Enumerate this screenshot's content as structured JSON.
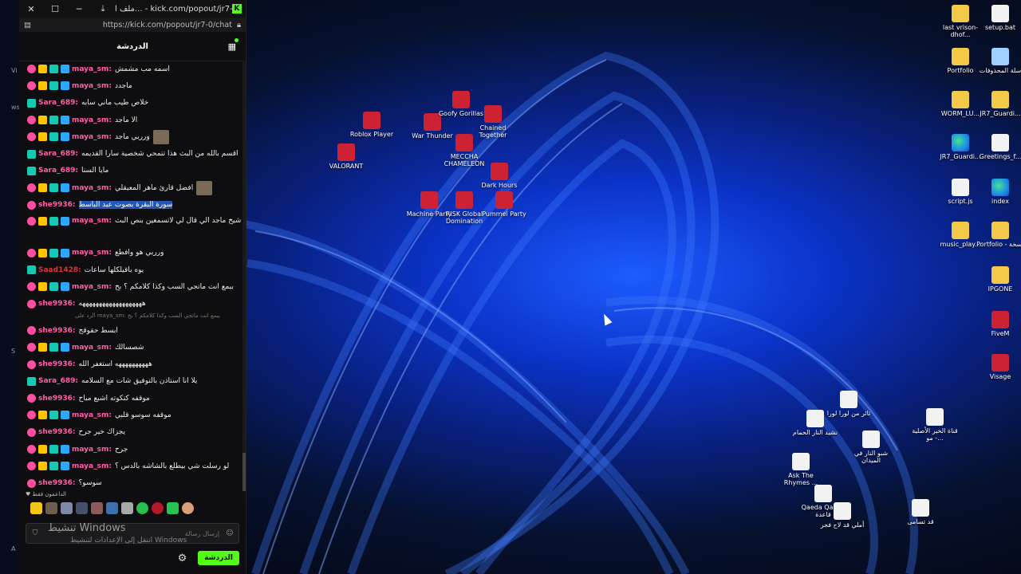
{
  "window": {
    "tab_title": "ملف ا... - kick.com/popout/jr7-0/chat",
    "url": "https://kick.com/popout/jr7-0/chat",
    "close_glyph": "✕",
    "maximize_glyph": "☐",
    "minimize_glyph": "─",
    "download_glyph": "⤓"
  },
  "chat": {
    "title": "الدردشة",
    "messages": [
      {
        "user": "maya_sm:",
        "color": "#ff5fa8",
        "badges": [
          "og",
          "vip",
          "sub",
          "fol"
        ],
        "text": "اسمه مب مشمش"
      },
      {
        "user": "maya_sm:",
        "color": "#ff5fa8",
        "badges": [
          "og",
          "vip",
          "sub",
          "fol"
        ],
        "text": "ماجدد"
      },
      {
        "user": "Sara_689:",
        "color": "#ff5fa8",
        "badges": [
          "sub"
        ],
        "text": "خلاص طيب ماني سابه"
      },
      {
        "user": "maya_sm:",
        "color": "#ff5fa8",
        "badges": [
          "og",
          "vip",
          "sub",
          "fol"
        ],
        "text": "الا ماجد"
      },
      {
        "user": "maya_sm:",
        "color": "#ff5fa8",
        "badges": [
          "og",
          "vip",
          "sub",
          "fol"
        ],
        "text": "ورربي ماجد",
        "emote": true
      },
      {
        "user": "Sara_689:",
        "color": "#ff5fa8",
        "badges": [
          "sub"
        ],
        "text": "اقسم بالله من البث هذا تتمحي شخصية سارا القديمه"
      },
      {
        "user": "Sara_689:",
        "color": "#ff5fa8",
        "badges": [
          "sub"
        ],
        "text": "مايا السنا"
      },
      {
        "user": "maya_sm:",
        "color": "#ff5fa8",
        "badges": [
          "og",
          "vip",
          "sub",
          "fol"
        ],
        "text": "افضل قارئ ماهر المعيقلي",
        "emote": true
      },
      {
        "user": "she9936:",
        "color": "#ff5fa8",
        "badges": [
          "og"
        ],
        "text": "سورة البقرة بصوت عبد الباسط",
        "highlight": true
      },
      {
        "user": "maya_sm:",
        "color": "#ff5fa8",
        "badges": [
          "og",
          "vip",
          "sub",
          "fol"
        ],
        "text": "ياشيخ ماجد الي قال لي لاتسمعين بنص البث",
        "tall": true
      },
      {
        "user": "maya_sm:",
        "color": "#ff5fa8",
        "badges": [
          "og",
          "vip",
          "sub",
          "fol"
        ],
        "text": "ورربي هو وافطع"
      },
      {
        "user": "Saad1428:",
        "color": "#e0323a",
        "badges": [
          "sub"
        ],
        "text": "يوه باقيلكلها ساعات"
      },
      {
        "user": "maya_sm:",
        "color": "#ff5fa8",
        "badges": [
          "og",
          "vip",
          "sub",
          "fol"
        ],
        "text": "ببمع انت ماتجي السب وكذا كلامكم ؟ بخ"
      },
      {
        "user": "she9936:",
        "color": "#ff5fa8",
        "badges": [
          "og"
        ],
        "text": "هههههههههههههههههههه"
      },
      {
        "reply": "الرد على maya_sm: يبمع انت ماتجي السب وكذا كلامكم ؟ بخ"
      },
      {
        "user": "she9936:",
        "color": "#ff5fa8",
        "badges": [
          "og"
        ],
        "text": "ابسط حقوقج"
      },
      {
        "user": "maya_sm:",
        "color": "#ff5fa8",
        "badges": [
          "og",
          "vip",
          "sub",
          "fol"
        ],
        "text": "شصسالك"
      },
      {
        "user": "she9936:",
        "color": "#ff5fa8",
        "badges": [
          "og"
        ],
        "text": "ههههههههههه استغفر الله"
      },
      {
        "user": "Sara_689:",
        "color": "#ff5fa8",
        "badges": [
          "sub"
        ],
        "text": "يلا انا استاذن بالتوفيق شات مع السلامه"
      },
      {
        "user": "she9936:",
        "color": "#ff5fa8",
        "badges": [
          "og"
        ],
        "text": "موقفه كتكوته اشبع مباح"
      },
      {
        "user": "maya_sm:",
        "color": "#ff5fa8",
        "badges": [
          "og",
          "vip",
          "sub",
          "fol"
        ],
        "text": "موقفه سوسو قلبي"
      },
      {
        "user": "she9936:",
        "color": "#ff5fa8",
        "badges": [
          "og"
        ],
        "text": "يجزاك خير جرح"
      },
      {
        "user": "maya_sm:",
        "color": "#ff5fa8",
        "badges": [
          "og",
          "vip",
          "sub",
          "fol"
        ],
        "text": "جرح"
      },
      {
        "user": "maya_sm:",
        "color": "#ff5fa8",
        "badges": [
          "og",
          "vip",
          "sub",
          "fol"
        ],
        "text": "لو رسلت شي بيطلع بالشاشه بالدس ؟"
      },
      {
        "user": "she9936:",
        "color": "#ff5fa8",
        "badges": [
          "og"
        ],
        "text": "سوسو؟"
      }
    ],
    "supporters_label": "♥ الداعمون فقط",
    "input_placeholder": "إرسال رسالة",
    "send_label": "الدردشة",
    "gear_glyph": "⚙",
    "smile_glyph": "☺",
    "shield_glyph": "⛉"
  },
  "watermark": {
    "line1": "تنشيط Windows",
    "line2": "انتقل إلى الإعدادات لتنشيط Windows"
  },
  "left_strip": [
    "Vi",
    "ws",
    "S",
    "A"
  ],
  "desktop_icons": [
    {
      "label": "Roblox Player",
      "type": "game"
    },
    {
      "label": "War Thunder",
      "type": "game"
    },
    {
      "label": "Goofy Gorillas",
      "type": "game"
    },
    {
      "label": "Chained Together",
      "type": "game"
    },
    {
      "label": "VALORANT",
      "type": "game"
    },
    {
      "label": "MECCHA CHAMELEON",
      "type": "game"
    },
    {
      "label": "Dark Hours",
      "type": "game"
    },
    {
      "label": "Machine Party",
      "type": "game"
    },
    {
      "label": "RISK Global Domination",
      "type": "game"
    },
    {
      "label": "Pummel Party",
      "type": "game"
    },
    {
      "label": "last vrison-dhof...",
      "type": "folder"
    },
    {
      "label": "setup.bat",
      "type": "doc"
    },
    {
      "label": "Portfolio",
      "type": "folder"
    },
    {
      "label": "سلة المحذوفات",
      "type": "bin"
    },
    {
      "label": "WORM_LU...",
      "type": "folder"
    },
    {
      "label": "JR7_Guardi...",
      "type": "folder"
    },
    {
      "label": "JR7_Guardi...",
      "type": "edge"
    },
    {
      "label": "Greetings_f...",
      "type": "doc"
    },
    {
      "label": "script.js",
      "type": "doc"
    },
    {
      "label": "index",
      "type": "edge"
    },
    {
      "label": "music_play...",
      "type": "folder"
    },
    {
      "label": "Portfolio - نسخة",
      "type": "folder"
    },
    {
      "label": "IPGONE",
      "type": "folder"
    },
    {
      "label": "FiveM",
      "type": "game"
    },
    {
      "label": "Visage",
      "type": "game"
    },
    {
      "label": "ثائر من لورا لورا",
      "type": "mp4"
    },
    {
      "label": "قناة الخير الأصلية - مو...",
      "type": "mp4"
    },
    {
      "label": "نشيد النار الحمام",
      "type": "mp4"
    },
    {
      "label": "شبو النار في الميدان",
      "type": "mp4"
    },
    {
      "label": "Ask The Rhymes ...",
      "type": "mp4"
    },
    {
      "label": "Qaeda Qaeda قاعدة",
      "type": "mp4"
    },
    {
      "label": "أملي قد لاح فجر",
      "type": "mp4"
    },
    {
      "label": "قد تسامى",
      "type": "mp4"
    }
  ]
}
